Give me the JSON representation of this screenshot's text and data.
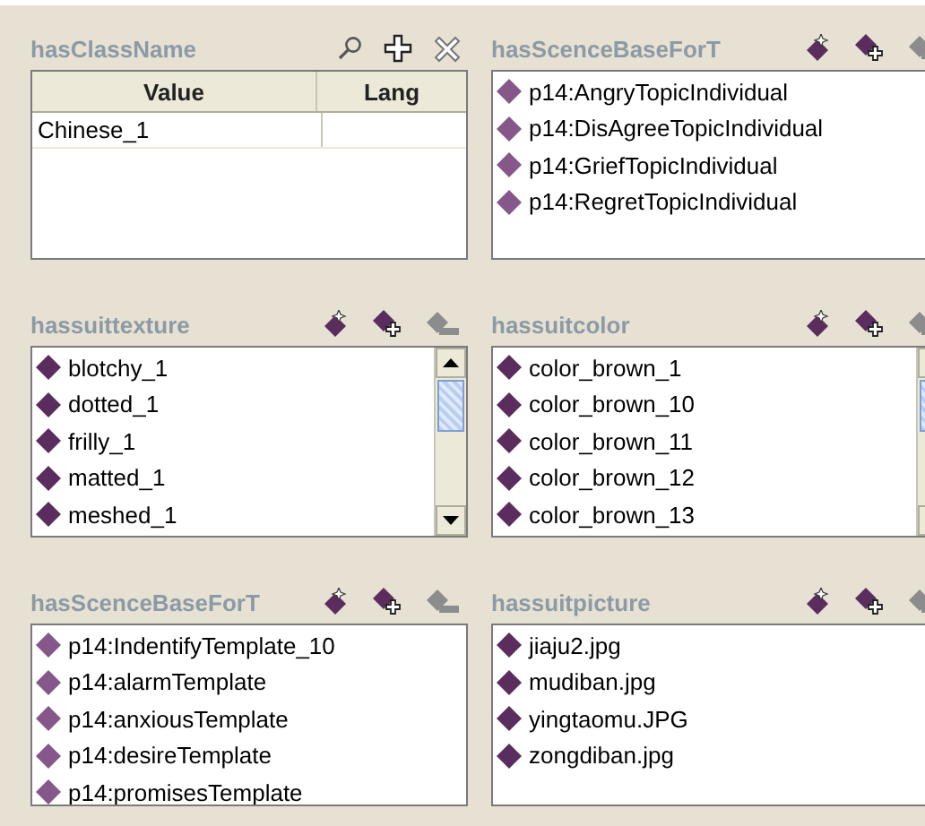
{
  "panels": [
    {
      "kind": "table",
      "title": "hasClassName",
      "columns": [
        "Value",
        "Lang"
      ],
      "rows": [
        {
          "value": "Chinese_1"
        }
      ]
    },
    {
      "kind": "list",
      "title": "hasScenceBaseForT",
      "scrollable": false,
      "items": [
        {
          "label": "p14:AngryTopicIndividual",
          "kind": "light"
        },
        {
          "label": "p14:DisAgreeTopicIndividual",
          "kind": "light"
        },
        {
          "label": "p14:GriefTopicIndividual",
          "kind": "light"
        },
        {
          "label": "p14:RegretTopicIndividual",
          "kind": "light"
        }
      ]
    },
    {
      "kind": "list",
      "title": "hassuittexture",
      "scrollable": true,
      "items": [
        {
          "label": "blotchy_1",
          "kind": "dark"
        },
        {
          "label": "dotted_1",
          "kind": "dark"
        },
        {
          "label": "frilly_1",
          "kind": "dark"
        },
        {
          "label": "matted_1",
          "kind": "dark"
        },
        {
          "label": "meshed_1",
          "kind": "dark"
        }
      ]
    },
    {
      "kind": "list",
      "title": "hassuitcolor",
      "scrollable": true,
      "items": [
        {
          "label": "color_brown_1",
          "kind": "dark"
        },
        {
          "label": "color_brown_10",
          "kind": "dark"
        },
        {
          "label": "color_brown_11",
          "kind": "dark"
        },
        {
          "label": "color_brown_12",
          "kind": "dark"
        },
        {
          "label": "color_brown_13",
          "kind": "dark"
        }
      ]
    },
    {
      "kind": "list",
      "title": "hasScenceBaseForT",
      "scrollable": false,
      "items": [
        {
          "label": "p14:IndentifyTemplate_10",
          "kind": "light"
        },
        {
          "label": "p14:alarmTemplate",
          "kind": "light"
        },
        {
          "label": "p14:anxiousTemplate",
          "kind": "light"
        },
        {
          "label": "p14:desireTemplate",
          "kind": "light"
        },
        {
          "label": "p14:promisesTemplate",
          "kind": "light"
        }
      ]
    },
    {
      "kind": "list",
      "title": "hassuitpicture",
      "scrollable": false,
      "items": [
        {
          "label": "jiaju2.jpg",
          "kind": "dark"
        },
        {
          "label": "mudiban.jpg",
          "kind": "dark"
        },
        {
          "label": "yingtaomu.JPG",
          "kind": "dark"
        },
        {
          "label": "zongdiban.jpg",
          "kind": "dark"
        }
      ]
    }
  ]
}
